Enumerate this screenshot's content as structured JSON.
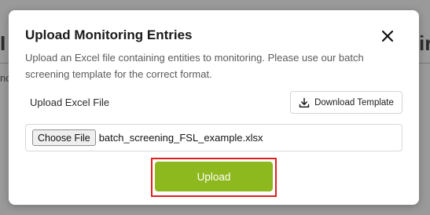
{
  "modal": {
    "title": "Upload Monitoring Entries",
    "description": "Upload an Excel file containing entities to monitoring. Please use our batch screening template for the correct format.",
    "close_icon": "close-icon"
  },
  "upload_field": {
    "label": "Upload Excel File",
    "download_template_label": "Download Template",
    "download_icon": "download-icon",
    "choose_file_label": "Choose File",
    "selected_file_name": "batch_screening_FSL_example.xlsx"
  },
  "actions": {
    "upload_label": "Upload"
  },
  "background": {
    "frag_left_title": "I",
    "frag_left_text": "no",
    "frag_right_title": "ir",
    "frag_right_text": ""
  },
  "colors": {
    "primary_button": "#8db81e",
    "highlight_border": "#e02020",
    "overlay": "#8a8a8a"
  }
}
